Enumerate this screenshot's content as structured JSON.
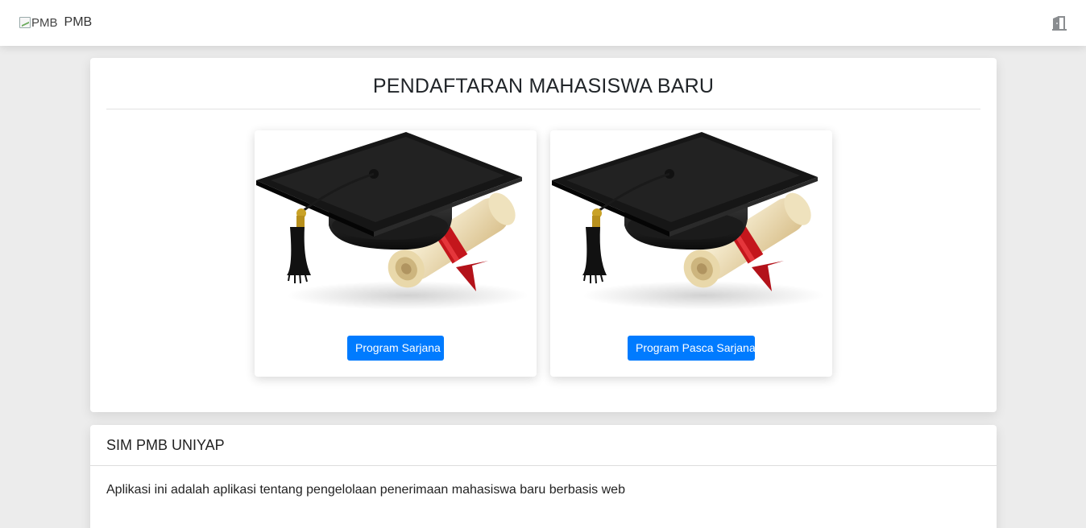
{
  "navbar": {
    "logo_alt": "PMB",
    "brand": "PMB",
    "logout_icon": "door-exit-icon"
  },
  "main_card": {
    "title": "PENDAFTARAN MAHASISWA BARU",
    "programs": [
      {
        "image": "graduation-cap-diploma-image",
        "button_label": "Program Sarjana"
      },
      {
        "image": "graduation-cap-diploma-image",
        "button_label": "Program Pasca Sarjana"
      }
    ]
  },
  "info_card": {
    "title": "SIM PMB UNIYAP",
    "description": "Aplikasi ini adalah aplikasi tentang pengelolaan penerimaan mahasiswa baru berbasis web"
  },
  "colors": {
    "primary": "#007bff",
    "background": "#ececec"
  }
}
